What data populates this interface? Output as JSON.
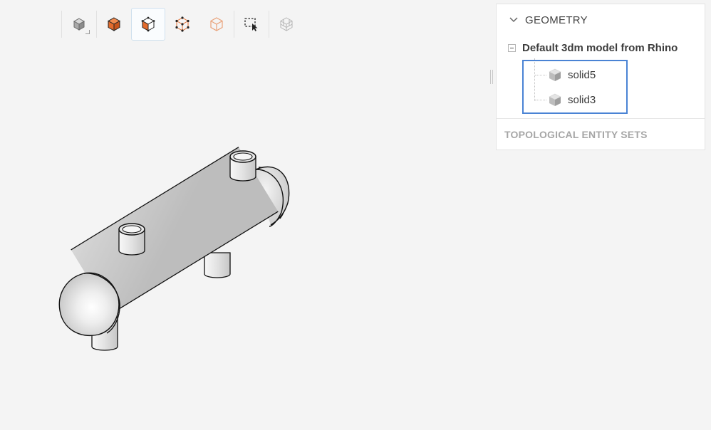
{
  "toolbar": {
    "buttons": [
      {
        "name": "view-cube-button",
        "icon": "view-cube-icon"
      },
      {
        "name": "solid-select-button",
        "icon": "solid-select-icon"
      },
      {
        "name": "face-select-button",
        "icon": "face-select-icon",
        "active": true
      },
      {
        "name": "vertex-select-button",
        "icon": "vertex-select-icon"
      },
      {
        "name": "edge-select-button",
        "icon": "edge-select-icon"
      },
      {
        "name": "box-select-button",
        "icon": "box-select-icon"
      },
      {
        "name": "mesh-select-button",
        "icon": "mesh-select-icon"
      }
    ]
  },
  "geometry_panel": {
    "title": "GEOMETRY",
    "root": {
      "label": "Default 3dm model from Rhino",
      "expanded": true
    },
    "items": [
      {
        "label": "solid5",
        "icon": "cube-icon"
      },
      {
        "label": "solid3",
        "icon": "cube-icon"
      }
    ]
  },
  "topological_panel": {
    "title": "TOPOLOGICAL ENTITY SETS"
  },
  "colors": {
    "accent_orange": "#e36b2c",
    "highlight_blue": "#4a83d4",
    "background": "#f4f4f4"
  }
}
